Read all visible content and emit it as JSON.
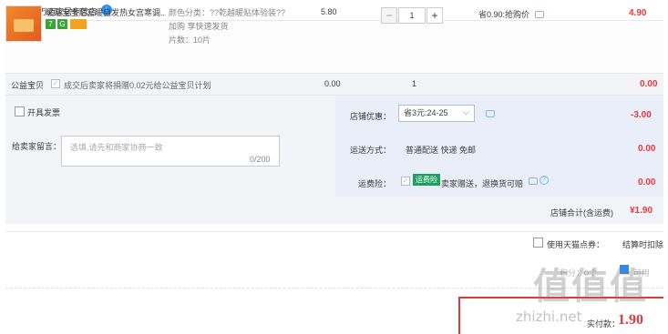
{
  "shop": {
    "icon_text": "店",
    "label": "店铺: 万迈家居专营店",
    "badge": "i"
  },
  "product": {
    "title": "暖贴宝宝贴宫暖自发热女宫寒调...",
    "icons": [
      "7",
      "G",
      "card"
    ],
    "attr_color": "颜色分类：??乾越暖贴体验装??",
    "attr_shipping": "加购  享快速发货",
    "attr_count": "片数：10片",
    "unit_price": "5.80",
    "qty_minus": "−",
    "qty": "1",
    "qty_plus": "+",
    "promo": "省0.90:抢购价",
    "total": "4.90"
  },
  "charity": {
    "label": "公益宝贝",
    "check": "✓",
    "text": "成交后卖家将捐赠0.02元给公益宝贝计划",
    "price": "0.00",
    "qty": "1",
    "total": "0.00"
  },
  "options": {
    "invoice_label": "开具发票",
    "note_label": "给卖家留言：",
    "note_placeholder": "选填,请先和商家协商一致",
    "note_count": "0/200",
    "discount_label": "店铺优惠：",
    "discount_value": "省3元:24-25",
    "discount_arrow": "⌵",
    "discount_total": "-3.00",
    "ship_label": "运送方式：",
    "ship_text": "普通配送 快递 免邮",
    "ship_total": "0.00",
    "ins_label": "运费险：",
    "ins_check": "✓",
    "ins_badge": "运费险",
    "ins_text": "卖家赠送，退换货可赔",
    "ins_help": "?",
    "ins_total": "0.00",
    "subtotal_label": "店铺合计(含运费)",
    "subtotal_value": "¥1.90"
  },
  "footer": {
    "tmall_label": "使用天猫点券：",
    "deduct_label": "结算时扣除",
    "points_label": "积分：0个",
    "points_text": "可用",
    "pay_label": "实付款：",
    "pay_value": "1.90"
  },
  "watermark": {
    "logo": "值值值",
    "text": "zhizhi.net"
  },
  "colors": {
    "accent_red": "#e4393c",
    "info_blue": "#2d8cf0",
    "panel_bg": "#f2f4f8",
    "panel_bg_blue": "#e9eef8",
    "badge_green": "#20a060"
  }
}
